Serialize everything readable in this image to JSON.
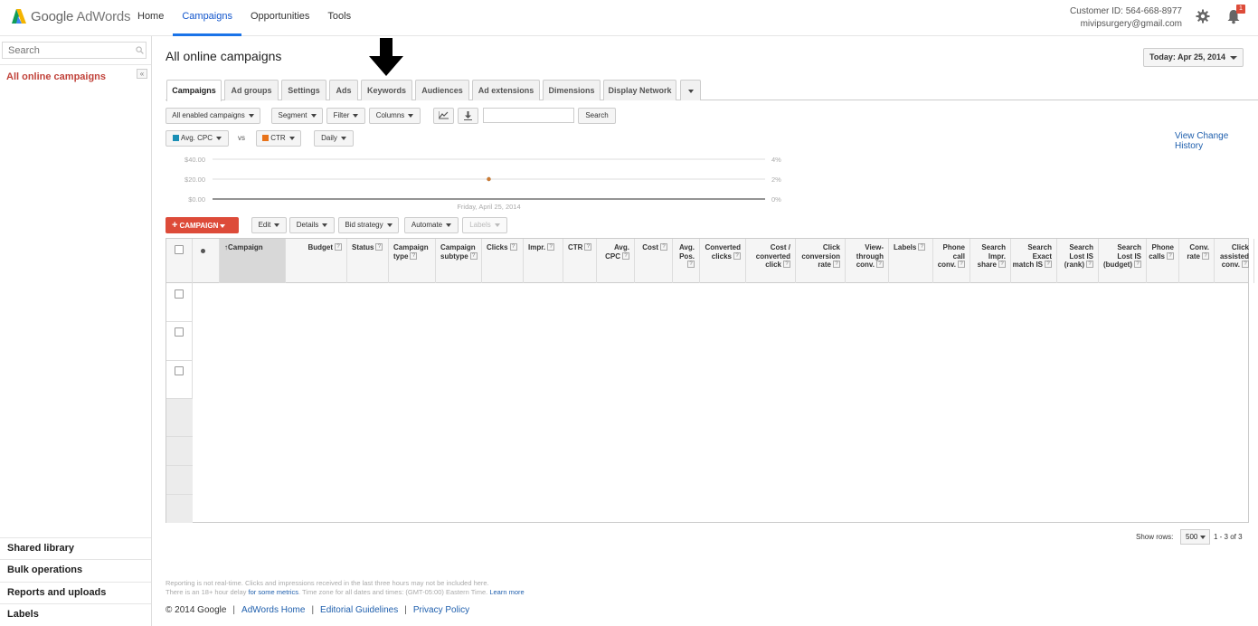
{
  "header": {
    "logo_google": "Google",
    "logo_adwords": "AdWords",
    "nav": [
      "Home",
      "Campaigns",
      "Opportunities",
      "Tools"
    ],
    "active_nav": "Campaigns",
    "customer_id": "Customer ID: 564-668-8977",
    "email": "mivipsurgery@gmail.com",
    "notification_count": "1",
    "accent_color": "#1a73e8"
  },
  "sidebar": {
    "search_placeholder": "Search",
    "collapse_label": "«",
    "active_item": "All online campaigns",
    "bottom_items": [
      "Shared library",
      "Bulk operations",
      "Reports and uploads",
      "Labels"
    ]
  },
  "main": {
    "title": "All online campaigns",
    "date_range": "Today: Apr 25, 2014",
    "tabs": [
      "Campaigns",
      "Ad groups",
      "Settings",
      "Ads",
      "Keywords",
      "Audiences",
      "Ad extensions",
      "Dimensions",
      "Display Network"
    ],
    "active_tab": "Campaigns",
    "toolbar": {
      "filter_status": "All enabled campaigns",
      "segment": "Segment",
      "filter": "Filter",
      "columns": "Columns",
      "search_button": "Search"
    },
    "chart_controls": {
      "metric1": "Avg. CPC",
      "metric1_color": "#1a8fb5",
      "vs": "vs",
      "metric2": "CTR",
      "metric2_color": "#e8731a",
      "interval": "Daily",
      "view_change_history": "View Change History"
    },
    "actions": {
      "campaign": "CAMPAIGN",
      "edit": "Edit",
      "details": "Details",
      "bid_strategy": "Bid strategy",
      "automate": "Automate",
      "labels": "Labels"
    },
    "table": {
      "columns": [
        "Campaign",
        "Budget",
        "Status",
        "Campaign type",
        "Campaign subtype",
        "Clicks",
        "Impr.",
        "CTR",
        "Avg. CPC",
        "Cost",
        "Avg. Pos.",
        "Converted clicks",
        "Cost / converted click",
        "Click conversion rate",
        "View-through conv.",
        "Labels",
        "Phone call conv.",
        "Search Impr. share",
        "Search Exact match IS",
        "Search Lost IS (rank)",
        "Search Lost IS (budget)",
        "Phone calls",
        "Conv. rate",
        "Click assisted conv."
      ],
      "sorted_column": "Campaign",
      "row_count": 3
    },
    "pagination": {
      "show_rows_label": "Show rows:",
      "rows_value": "500",
      "range": "1 - 3 of 3"
    },
    "footer": {
      "note_line1": "Reporting is not real-time. Clicks and impressions received in the last three hours may not be included here.",
      "note_line2_prefix": "There is an 18+ hour delay",
      "note_line2_link": "for some metrics",
      "note_line2_suffix": ". Time zone for all dates and times: (GMT-05:00) Eastern Time.",
      "learn_more": "Learn more",
      "copyright": "© 2014 Google",
      "links": [
        "AdWords Home",
        "Editorial Guidelines",
        "Privacy Policy"
      ]
    }
  },
  "chart_data": {
    "type": "line",
    "x": [
      "Friday, April 25, 2014"
    ],
    "series": [
      {
        "name": "Avg. CPC",
        "values": [
          20.0
        ],
        "color": "#1a8fb5",
        "axis": "left"
      },
      {
        "name": "CTR",
        "values": [
          2
        ],
        "color": "#e8731a",
        "axis": "right"
      }
    ],
    "left_ticks": [
      "$40.00",
      "$20.00",
      "$0.00"
    ],
    "right_ticks": [
      "4%",
      "2%",
      "0%"
    ],
    "x_tick_label": "Friday, April 25, 2014",
    "ylim_left": [
      0,
      40
    ],
    "ylim_right": [
      0,
      4
    ],
    "grid": true
  }
}
